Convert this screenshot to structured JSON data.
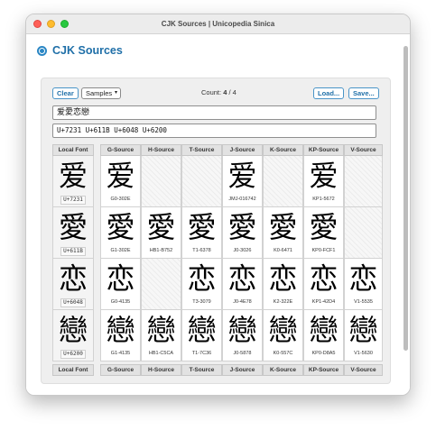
{
  "window": {
    "title": "CJK Sources | Unicopedia Sinica"
  },
  "page": {
    "heading": "CJK Sources"
  },
  "toolbar": {
    "clear_label": "Clear",
    "samples_label": "Samples",
    "count_label": "Count:",
    "count_value": "4",
    "count_total": "/ 4",
    "load_label": "Load...",
    "save_label": "Save..."
  },
  "inputs": {
    "characters": "爱愛恋戀",
    "code_points": "U+7231 U+611B U+6048 U+6200"
  },
  "table": {
    "headers": [
      "Local Font",
      "G-Source",
      "H-Source",
      "T-Source",
      "J-Source",
      "K-Source",
      "KP-Source",
      "V-Source"
    ],
    "rows": [
      {
        "local": {
          "glyph": "爱",
          "code": "U+7231"
        },
        "sources": [
          {
            "glyph": "爱",
            "ref": "G0-302E"
          },
          null,
          null,
          {
            "glyph": "爱",
            "ref": "JMJ-016742"
          },
          null,
          {
            "glyph": "爱",
            "ref": "KP1-5672"
          },
          null
        ]
      },
      {
        "local": {
          "glyph": "愛",
          "code": "U+611B"
        },
        "sources": [
          {
            "glyph": "愛",
            "ref": "G1-302E"
          },
          {
            "glyph": "愛",
            "ref": "HB1-B752"
          },
          {
            "glyph": "愛",
            "ref": "T1-6378"
          },
          {
            "glyph": "愛",
            "ref": "J0-3026"
          },
          {
            "glyph": "愛",
            "ref": "K0-6471"
          },
          {
            "glyph": "愛",
            "ref": "KP0-FCF1"
          },
          null
        ]
      },
      {
        "local": {
          "glyph": "恋",
          "code": "U+6048"
        },
        "sources": [
          {
            "glyph": "恋",
            "ref": "G0-4135"
          },
          null,
          {
            "glyph": "恋",
            "ref": "T3-3079"
          },
          {
            "glyph": "恋",
            "ref": "J0-4E78"
          },
          {
            "glyph": "恋",
            "ref": "K2-322E"
          },
          {
            "glyph": "恋",
            "ref": "KP1-42D4"
          },
          {
            "glyph": "恋",
            "ref": "V1-5535"
          }
        ]
      },
      {
        "local": {
          "glyph": "戀",
          "code": "U+6200"
        },
        "sources": [
          {
            "glyph": "戀",
            "ref": "G1-4135"
          },
          {
            "glyph": "戀",
            "ref": "HB1-C5CA"
          },
          {
            "glyph": "戀",
            "ref": "T1-7C36"
          },
          {
            "glyph": "戀",
            "ref": "J0-5878"
          },
          {
            "glyph": "戀",
            "ref": "K0-557C"
          },
          {
            "glyph": "戀",
            "ref": "KP0-D8A5"
          },
          {
            "glyph": "戀",
            "ref": "V1-5630"
          }
        ]
      }
    ]
  },
  "colors": {
    "accent": "#1f6fa8",
    "panel": "#efefef"
  }
}
